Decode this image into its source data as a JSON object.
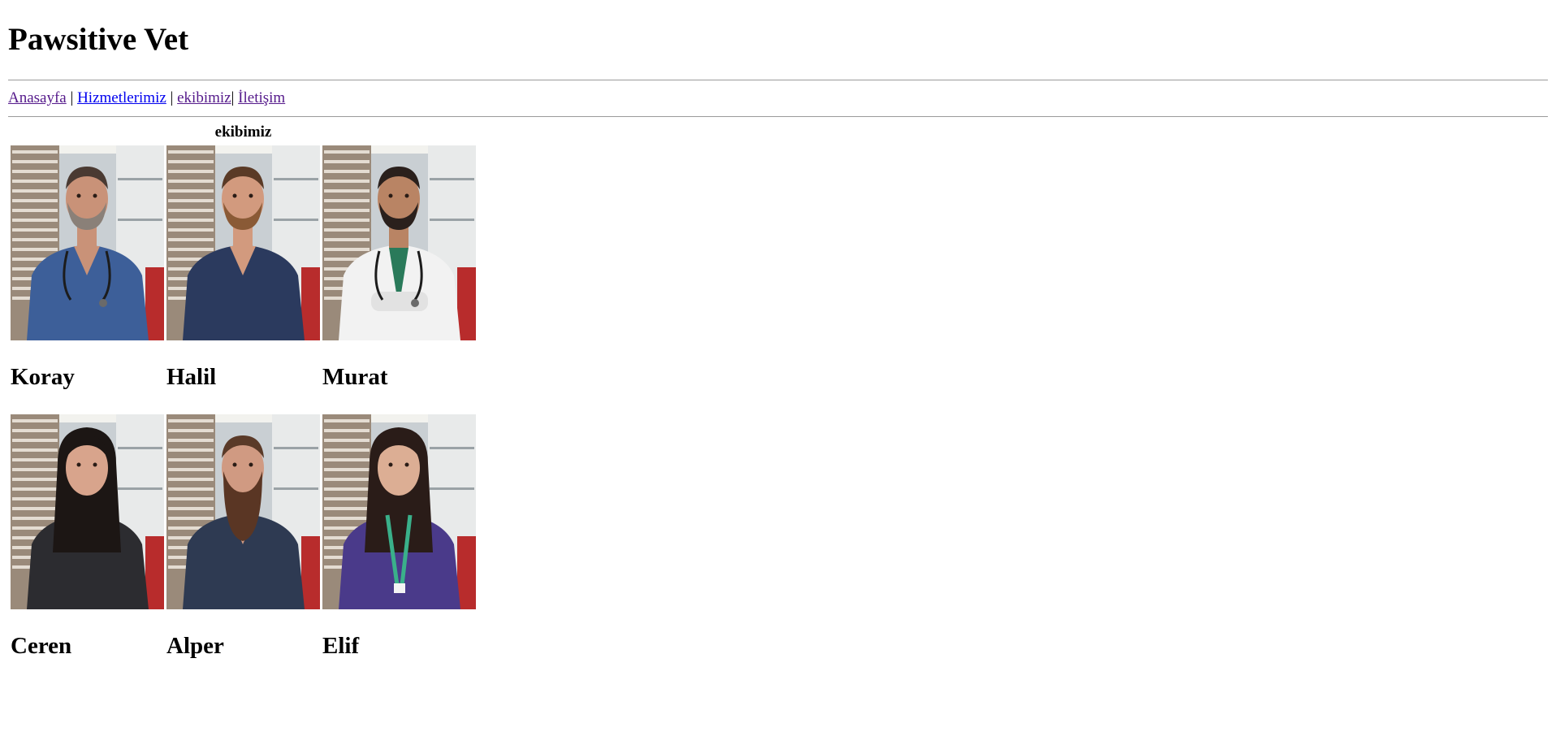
{
  "site": {
    "title": "Pawsitive Vet"
  },
  "nav": {
    "items": [
      {
        "label": "Anasayfa",
        "state": "visited"
      },
      {
        "label": "Hizmetlerimiz",
        "state": "unvisited"
      },
      {
        "label": "ekibimiz",
        "state": "visited"
      },
      {
        "label": "İletişim",
        "state": "visited"
      }
    ],
    "separator": "|"
  },
  "team": {
    "caption": "ekibimiz",
    "members": [
      {
        "name": "Koray",
        "scrub": "#3d5f99",
        "coat": "",
        "skin": "#c99278",
        "hair": "#4a3a32",
        "beard": "#8a8078"
      },
      {
        "name": "Halil",
        "scrub": "#2b3a5e",
        "coat": "",
        "skin": "#d29a7e",
        "hair": "#5a3a26",
        "beard": "#8a5a36"
      },
      {
        "name": "Murat",
        "scrub": "#f4f4f4",
        "coat": "white",
        "skin": "#b98464",
        "hair": "#2a201c",
        "beard": "#2a201c"
      },
      {
        "name": "Ceren",
        "scrub": "#2c2c30",
        "coat": "",
        "skin": "#d8a48c",
        "hair": "#1c1614",
        "beard": ""
      },
      {
        "name": "Alper",
        "scrub": "#2e3a52",
        "coat": "",
        "skin": "#d09a82",
        "hair": "#5a3a28",
        "beard": "#5a3624"
      },
      {
        "name": "Elif",
        "scrub": "#4a3a8a",
        "coat": "",
        "skin": "#dcae94",
        "hair": "#2a1c18",
        "beard": ""
      }
    ]
  },
  "colors": {
    "link_visited": "#551a8b",
    "link_unvisited": "#0000ee",
    "rule": "#9a9a9a"
  }
}
